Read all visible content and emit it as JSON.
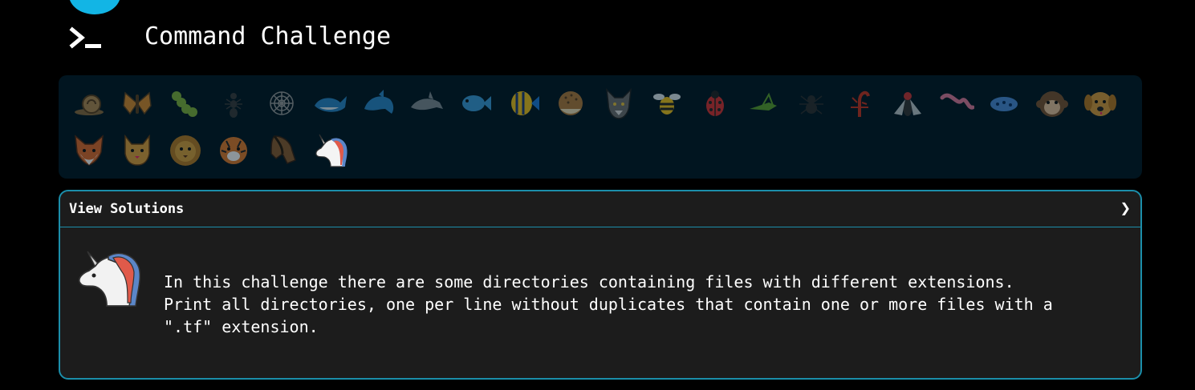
{
  "app": {
    "title": "Command Challenge"
  },
  "animals": [
    {
      "name": "snail",
      "color": "#8a6a3c"
    },
    {
      "name": "butterfly",
      "color": "#d98a2b"
    },
    {
      "name": "caterpillar",
      "color": "#7fb23a"
    },
    {
      "name": "ant",
      "color": "#3a3a3a"
    },
    {
      "name": "spider-web",
      "color": "#9a9a9a"
    },
    {
      "name": "whale",
      "color": "#2a86c8"
    },
    {
      "name": "dolphin",
      "color": "#2a86c8"
    },
    {
      "name": "dolphin-gray",
      "color": "#7f8a92"
    },
    {
      "name": "fish",
      "color": "#3a9bd8"
    },
    {
      "name": "tropical-fish",
      "color": "#f2c21a"
    },
    {
      "name": "pufferfish",
      "color": "#b07a3a"
    },
    {
      "name": "wolf",
      "color": "#6f6f6f"
    },
    {
      "name": "bee",
      "color": "#f2c21a"
    },
    {
      "name": "ladybug",
      "color": "#d93030"
    },
    {
      "name": "cricket",
      "color": "#5aa02c"
    },
    {
      "name": "spider",
      "color": "#2e2e2e"
    },
    {
      "name": "scorpion",
      "color": "#c8321e"
    },
    {
      "name": "fly",
      "color": "#888888"
    },
    {
      "name": "worm",
      "color": "#e07a9a"
    },
    {
      "name": "microbe",
      "color": "#4a8ad6"
    },
    {
      "name": "monkey",
      "color": "#7a5230"
    },
    {
      "name": "dog",
      "color": "#d99a3a"
    },
    {
      "name": "fox",
      "color": "#e0692a"
    },
    {
      "name": "cat",
      "color": "#e0a03a"
    },
    {
      "name": "lion",
      "color": "#d9a03a"
    },
    {
      "name": "tiger",
      "color": "#e07a2a"
    },
    {
      "name": "horse",
      "color": "#8a5a2e"
    },
    {
      "name": "unicorn",
      "color": "#ffffff"
    }
  ],
  "active_animal": "unicorn",
  "solutions": {
    "header_label": "View Solutions",
    "expand_icon": "chevron-right-icon",
    "description": "In this challenge there are some directories containing files with different extensions.\nPrint all directories, one per line without duplicates that contain one or more files with a\n\".tf\" extension."
  }
}
